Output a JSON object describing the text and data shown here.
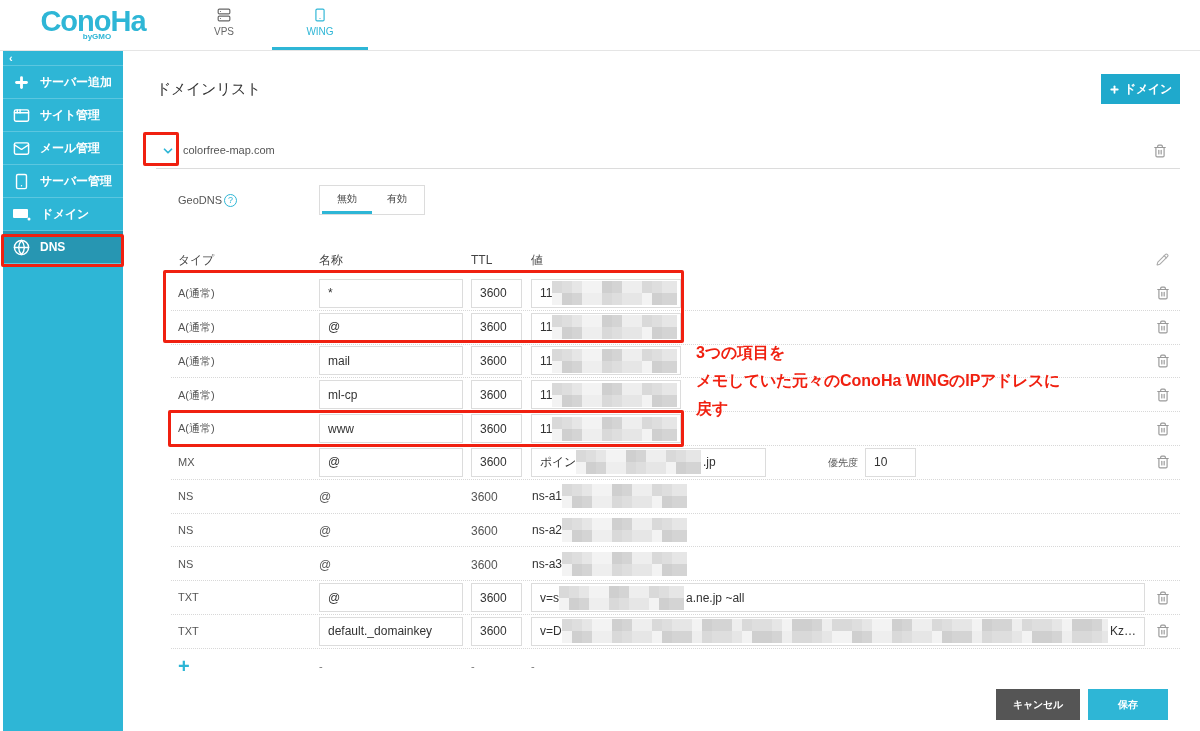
{
  "logo": {
    "name": "ConoHa",
    "sub": "byGMO"
  },
  "nav_tabs": [
    {
      "label": "VPS",
      "selected": false
    },
    {
      "label": "WING",
      "selected": true
    }
  ],
  "sidebar": {
    "collapse": "‹",
    "items": [
      {
        "label": "サーバー追加",
        "selected": false
      },
      {
        "label": "サイト管理",
        "selected": false
      },
      {
        "label": "メール管理",
        "selected": false
      },
      {
        "label": "サーバー管理",
        "selected": false
      },
      {
        "label": "ドメイン",
        "selected": false
      },
      {
        "label": "DNS",
        "selected": true
      }
    ]
  },
  "page_title": "ドメインリスト",
  "add_domain_button": "ドメイン",
  "domain": {
    "name": "colorfree-map.com",
    "expanded": true
  },
  "geodns": {
    "label": "GeoDNS",
    "help": "?",
    "options": [
      {
        "label": "無効",
        "selected": true
      },
      {
        "label": "有効",
        "selected": false
      }
    ]
  },
  "table": {
    "columns": [
      "タイプ",
      "名称",
      "TTL",
      "値"
    ],
    "rows": [
      {
        "kind": "a",
        "type": "A(通常)",
        "name": "*",
        "ttl": "3600",
        "value_prefix": "11"
      },
      {
        "kind": "a",
        "type": "A(通常)",
        "name": "@",
        "ttl": "3600",
        "value_prefix": "11"
      },
      {
        "kind": "a",
        "type": "A(通常)",
        "name": "mail",
        "ttl": "3600",
        "value_prefix": "11"
      },
      {
        "kind": "a",
        "type": "A(通常)",
        "name": "ml-cp",
        "ttl": "3600",
        "value_prefix": "11"
      },
      {
        "kind": "a",
        "type": "A(通常)",
        "name": "www",
        "ttl": "3600",
        "value_prefix": "11"
      },
      {
        "kind": "mx",
        "type": "MX",
        "name": "@",
        "ttl": "3600",
        "value_prefix": "ポイン",
        "value_suffix": ".jp",
        "priority_label": "優先度",
        "priority": "10"
      },
      {
        "kind": "ns",
        "type": "NS",
        "name": "@",
        "ttl": "3600",
        "value_prefix": "ns-a1"
      },
      {
        "kind": "ns",
        "type": "NS",
        "name": "@",
        "ttl": "3600",
        "value_prefix": "ns-a2"
      },
      {
        "kind": "ns",
        "type": "NS",
        "name": "@",
        "ttl": "3600",
        "value_prefix": "ns-a3"
      },
      {
        "kind": "txt",
        "type": "TXT",
        "name": "@",
        "ttl": "3600",
        "value_prefix": "v=s",
        "value_suffix": "a.ne.jp ~all"
      },
      {
        "kind": "txt",
        "type": "TXT",
        "name": "default._domainkey",
        "ttl": "3600",
        "value_prefix": "v=D",
        "value_suffix": "Kz…"
      }
    ],
    "new_row": {
      "add": "+",
      "name": "-",
      "ttl": "-",
      "value": "-"
    }
  },
  "buttons": {
    "cancel": "キャンセル",
    "save": "保存"
  },
  "annotation": [
    "3つの項目を",
    "メモしていた元々のConoHa WINGのIPアドレスに",
    "戻す"
  ]
}
